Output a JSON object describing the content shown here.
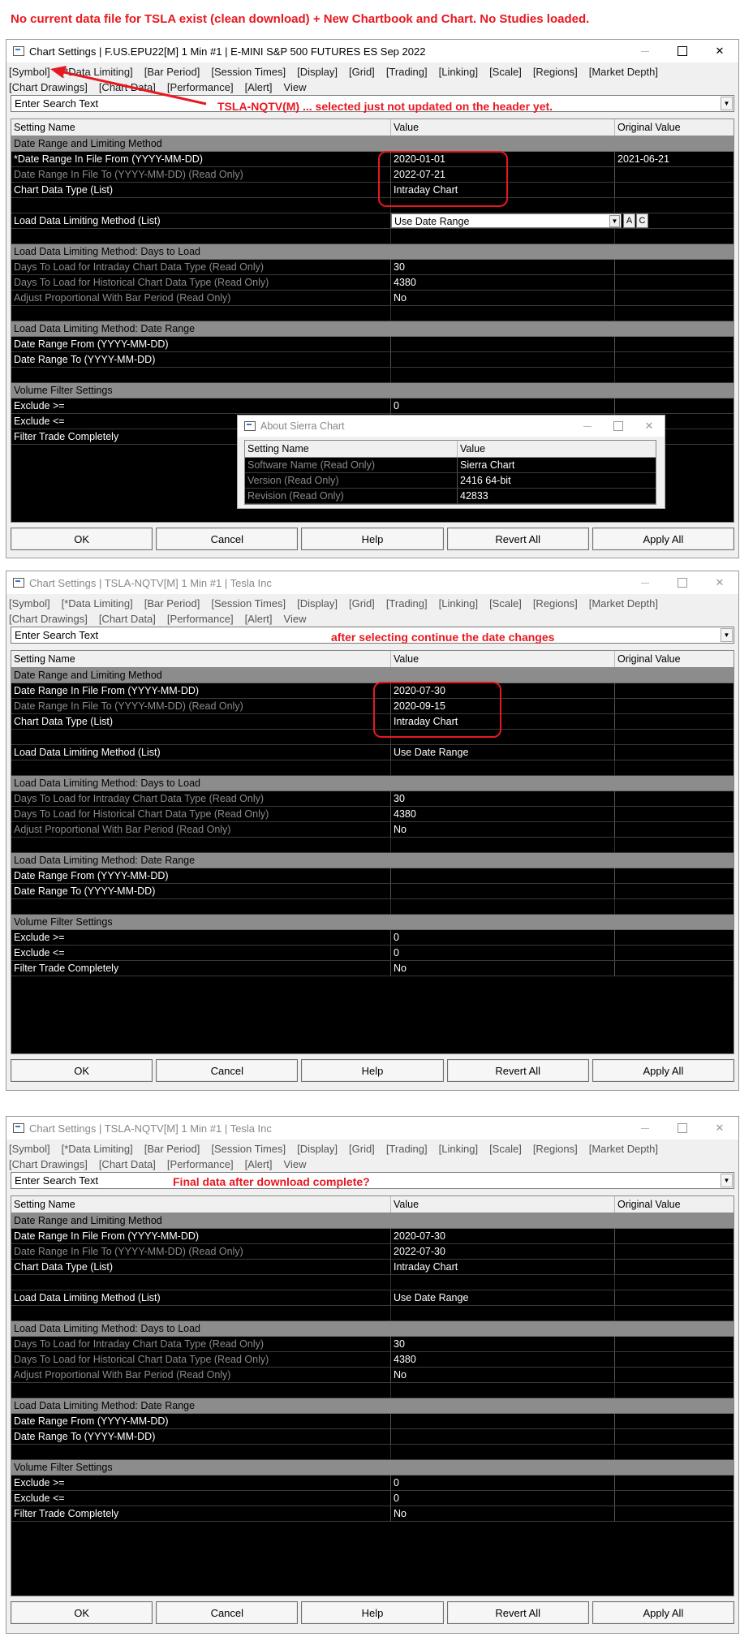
{
  "captions": {
    "top": "No current data file for TSLA exist (clean download)  + New Chartbook and Chart. No Studies loaded.",
    "symbol_note": "TSLA-NQTV(M) ... selected just not updated on the header yet.",
    "after_note": "after selecting continue the date changes",
    "final_note": "Final data after download complete?"
  },
  "common": {
    "menu": [
      "[Symbol]",
      "[*Data Limiting]",
      "[Bar Period]",
      "[Session Times]",
      "[Display]",
      "[Grid]",
      "[Trading]",
      "[Linking]",
      "[Scale]",
      "[Regions]",
      "[Market Depth]",
      "[Chart Drawings]",
      "[Chart Data]",
      "[Performance]",
      "[Alert]",
      "View"
    ],
    "search_placeholder": "Enter Search Text",
    "col_setting": "Setting Name",
    "col_value": "Value",
    "col_original": "Original Value",
    "buttons": {
      "ok": "OK",
      "cancel": "Cancel",
      "help": "Help",
      "revert": "Revert All",
      "apply": "Apply All"
    },
    "sections": {
      "date_range": "Date Range and Limiting Method",
      "days_to_load": "Load Data Limiting Method: Days to Load",
      "date_range2": "Load Data Limiting Method: Date Range",
      "volume": "Volume Filter Settings"
    },
    "labels": {
      "from": "Date Range In File From (YYYY-MM-DD)",
      "from_star": "*Date Range In File From (YYYY-MM-DD)",
      "to": "Date Range In File To (YYYY-MM-DD) (Read Only)",
      "type": "Chart Data Type (List)",
      "method": "Load Data Limiting Method (List)",
      "intraday_days": "Days To Load for Intraday Chart Data Type (Read Only)",
      "hist_days": "Days To Load for Historical Chart Data Type (Read Only)",
      "adjust": "Adjust Proportional With Bar Period (Read Only)",
      "dr_from": "Date Range From (YYYY-MM-DD)",
      "dr_to": "Date Range To (YYYY-MM-DD)",
      "excl_ge": "Exclude >=",
      "excl_le": "Exclude <=",
      "filter": "Filter Trade Completely"
    }
  },
  "window1": {
    "title": "Chart Settings | F.US.EPU22[M]  1 Min  #1 | E-MINI S&P 500 FUTURES ES Sep 2022",
    "from": "2020-01-01",
    "from_original": "2021-06-21",
    "to": "2022-07-21",
    "type": "Intraday Chart",
    "method": "Use Date Range",
    "btn_a": "A",
    "btn_c": "C",
    "intraday_days": "30",
    "hist_days": "4380",
    "adjust": "No",
    "excl_ge": "0"
  },
  "about": {
    "title": "About Sierra Chart",
    "col_setting": "Setting Name",
    "col_value": "Value",
    "rows": [
      {
        "label": "Software Name (Read Only)",
        "value": "Sierra Chart"
      },
      {
        "label": "Version (Read Only)",
        "value": "2416 64-bit"
      },
      {
        "label": "Revision (Read Only)",
        "value": "42833"
      }
    ]
  },
  "window2": {
    "title": "Chart Settings | TSLA-NQTV[M]  1 Min  #1 | Tesla Inc",
    "from": "2020-07-30",
    "to": "2020-09-15",
    "type": "Intraday Chart",
    "method": "Use Date Range",
    "intraday_days": "30",
    "hist_days": "4380",
    "adjust": "No",
    "excl_ge": "0",
    "excl_le": "0",
    "filter": "No"
  },
  "window3": {
    "title": "Chart Settings | TSLA-NQTV[M]  1 Min  #1 | Tesla Inc",
    "from": "2020-07-30",
    "to": "2022-07-30",
    "type": "Intraday Chart",
    "method": "Use Date Range",
    "intraday_days": "30",
    "hist_days": "4380",
    "adjust": "No",
    "excl_ge": "0",
    "excl_le": "0",
    "filter": "No"
  },
  "colors": {
    "annotation": "#e8181f",
    "section_bg": "#8c8c8c",
    "grid_bg": "#000000"
  }
}
